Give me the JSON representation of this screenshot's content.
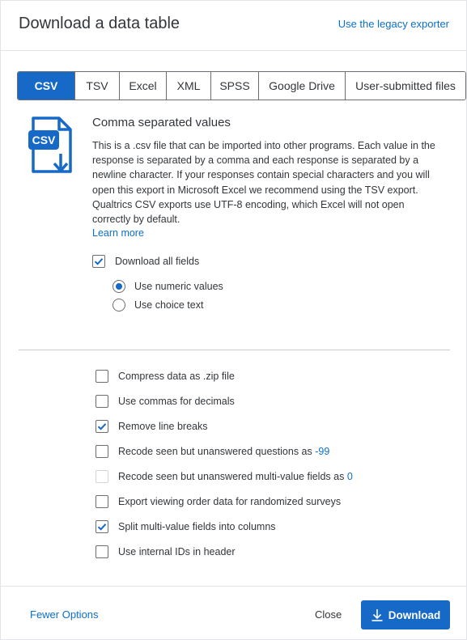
{
  "dialog": {
    "title": "Download a data table",
    "legacy_link": "Use the legacy exporter"
  },
  "tabs": [
    {
      "label": "CSV",
      "active": true
    },
    {
      "label": "TSV",
      "active": false
    },
    {
      "label": "Excel",
      "active": false
    },
    {
      "label": "XML",
      "active": false
    },
    {
      "label": "SPSS",
      "active": false
    },
    {
      "label": "Google Drive",
      "active": false
    },
    {
      "label": "User-submitted files",
      "active": false
    }
  ],
  "format": {
    "icon_text": "CSV",
    "icon": "csv-file-download-icon",
    "title": "Comma separated values",
    "description": "This is a .csv file that can be imported into other programs. Each value in the response is separated by a comma and each response is separated by a newline character. If your responses contain special characters and you will open this export in Microsoft Excel we recommend using the TSV export. Qualtrics CSV exports use UTF-8 encoding, which Excel will not open correctly by default.",
    "learn_more": "Learn more"
  },
  "fields": {
    "download_all": {
      "label": "Download all fields",
      "checked": true
    },
    "radios": [
      {
        "label": "Use numeric values",
        "selected": true
      },
      {
        "label": "Use choice text",
        "selected": false
      }
    ]
  },
  "options": [
    {
      "label": "Compress data as .zip file",
      "checked": false,
      "disabled": false
    },
    {
      "label": "Use commas for decimals",
      "checked": false,
      "disabled": false
    },
    {
      "label": "Remove line breaks",
      "checked": true,
      "disabled": false
    },
    {
      "label": "Recode seen but unanswered questions as ",
      "value": "-99",
      "checked": false,
      "disabled": false
    },
    {
      "label": "Recode seen but unanswered multi-value fields as ",
      "value": "0",
      "checked": false,
      "disabled": true
    },
    {
      "label": "Export viewing order data for randomized surveys",
      "checked": false,
      "disabled": false
    },
    {
      "label": "Split multi-value fields into columns",
      "checked": true,
      "disabled": false
    },
    {
      "label": "Use internal IDs in header",
      "checked": false,
      "disabled": false
    }
  ],
  "footer": {
    "fewer_options": "Fewer Options",
    "close": "Close",
    "download": "Download"
  },
  "colors": {
    "accent": "#1769c8",
    "link": "#0b6fca",
    "text": "#32363a"
  }
}
